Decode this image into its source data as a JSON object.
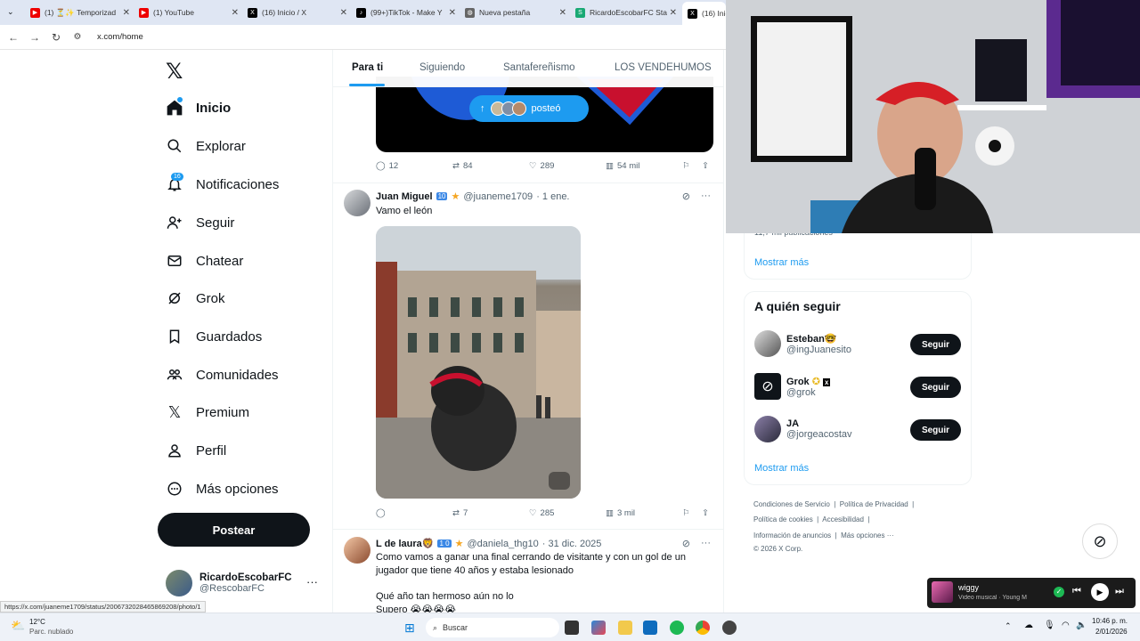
{
  "browser": {
    "tabs": [
      {
        "label": "(1) ⏳✨ Temporizad",
        "fav_color": "#e00"
      },
      {
        "label": "(1) YouTube",
        "fav_color": "#e00"
      },
      {
        "label": "(16) Inicio / X",
        "fav_color": "#000"
      },
      {
        "label": "(99+)TikTok - Make Y",
        "fav_color": "#000"
      },
      {
        "label": "Nueva pestaña",
        "fav_color": "#666"
      },
      {
        "label": "RicardoEscobarFC Sta",
        "fav_color": "#19a974"
      },
      {
        "label": "(16) Inic",
        "fav_color": "#000"
      }
    ],
    "url": "x.com/home",
    "status_url": "https://x.com/juaneme1709/status/2006732028465869208/photo/1"
  },
  "nav": {
    "items": [
      {
        "label": "Inicio",
        "icon": "home-icon"
      },
      {
        "label": "Explorar",
        "icon": "search-icon"
      },
      {
        "label": "Notificaciones",
        "icon": "bell-icon"
      },
      {
        "label": "Seguir",
        "icon": "person-add-icon"
      },
      {
        "label": "Chatear",
        "icon": "mail-icon"
      },
      {
        "label": "Grok",
        "icon": "grok-icon"
      },
      {
        "label": "Guardados",
        "icon": "bookmark-icon"
      },
      {
        "label": "Comunidades",
        "icon": "communities-icon"
      },
      {
        "label": "Premium",
        "icon": "x-logo-icon"
      },
      {
        "label": "Perfil",
        "icon": "person-icon"
      },
      {
        "label": "Más opciones",
        "icon": "more-icon"
      }
    ],
    "notif_count": "16",
    "post_label": "Postear",
    "user": {
      "name": "RicardoEscobarFC",
      "handle": "@RescobarFC"
    }
  },
  "feed": {
    "tabs": [
      "Para ti",
      "Siguiendo",
      "Santafereñismo",
      "LOS VENDEHUMOS"
    ],
    "posted_pill": "posteó",
    "tweets": [
      {
        "replies": "12",
        "reposts": "84",
        "likes": "289",
        "views": "54 mil"
      },
      {
        "name": "Juan Miguel",
        "badge": "10",
        "handle": "@juaneme1709",
        "date": "· 1 ene.",
        "text": "Vamo el león",
        "replies": "",
        "reposts": "7",
        "likes": "285",
        "views": "3 mil"
      },
      {
        "name": "L de laura🦁",
        "badge": "1 0",
        "handle": "@daniela_thg10",
        "date": "· 31 dic. 2025",
        "text1": "Como vamos a ganar una final cerrando de visitante y con un gol de un",
        "text2": "jugador que tiene 40 años y estaba lesionado",
        "text3": "Qué año tan hermoso aún no lo",
        "text4": "Supero 😭😭😭😭"
      }
    ]
  },
  "sidebar": {
    "trend_partial": "11,7 mil publicaciones",
    "show_more": "Mostrar más",
    "who_to_follow_title": "A quién seguir",
    "who_to_follow": [
      {
        "name": "Esteban🤓",
        "handle": "@ingJuanesito",
        "button": "Seguir"
      },
      {
        "name": "Grok",
        "handle": "@grok",
        "button": "Seguir"
      },
      {
        "name": "JA",
        "handle": "@jorgeacostav",
        "button": "Seguir"
      }
    ],
    "footer": [
      "Condiciones de Servicio",
      "Política de Privacidad",
      "Política de cookies",
      "Accesibilidad",
      "Información de anuncios",
      "Más opciones ···",
      "© 2026 X Corp."
    ]
  },
  "music": {
    "title": "wiggy",
    "subtitle": "Video musical · Young M"
  },
  "taskbar": {
    "temp": "12°C",
    "weather": "Parc. nublado",
    "search": "Buscar",
    "time": "10:46 p. m.",
    "date": "2/01/2026"
  }
}
